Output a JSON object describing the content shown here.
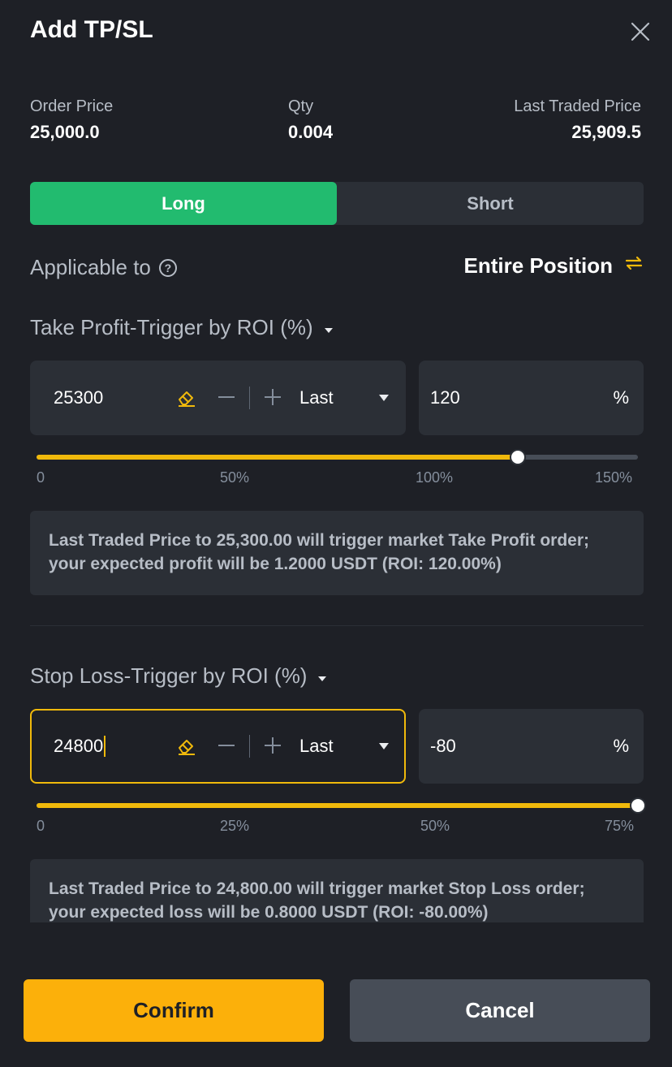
{
  "header": {
    "title": "Add TP/SL"
  },
  "summary": {
    "order_price_label": "Order Price",
    "order_price_value": "25,000.0",
    "qty_label": "Qty",
    "qty_value": "0.004",
    "last_price_label": "Last Traded Price",
    "last_price_value": "25,909.5"
  },
  "side_toggle": {
    "long_label": "Long",
    "short_label": "Short",
    "selected": "Long"
  },
  "applicable": {
    "label": "Applicable to",
    "help_icon": "?",
    "value": "Entire Position"
  },
  "take_profit": {
    "title": "Take Profit-Trigger by ROI (%)",
    "price": "25300",
    "trigger_type": "Last",
    "roi": "120",
    "roi_unit": "%",
    "slider_value_fraction": 0.8,
    "ticks": [
      "0",
      "50%",
      "100%",
      "150%"
    ],
    "note": "Last Traded Price to 25,300.00 will trigger market Take Profit order; your expected profit will be 1.2000 USDT (ROI: 120.00%)"
  },
  "stop_loss": {
    "title": "Stop Loss-Trigger by ROI (%)",
    "price": "24800",
    "trigger_type": "Last",
    "roi": "-80",
    "roi_unit": "%",
    "slider_value_fraction": 1.0,
    "ticks": [
      "0",
      "25%",
      "50%",
      "75%"
    ],
    "note": "Last Traded Price to 24,800.00 will trigger market Stop Loss order; your expected loss will be 0.8000 USDT (ROI: -80.00%)"
  },
  "footer": {
    "confirm_label": "Confirm",
    "cancel_label": "Cancel"
  },
  "colors": {
    "accent": "#f0b90b",
    "long": "#22bb6f",
    "background": "#1e2026",
    "panel": "#2b2f36"
  }
}
